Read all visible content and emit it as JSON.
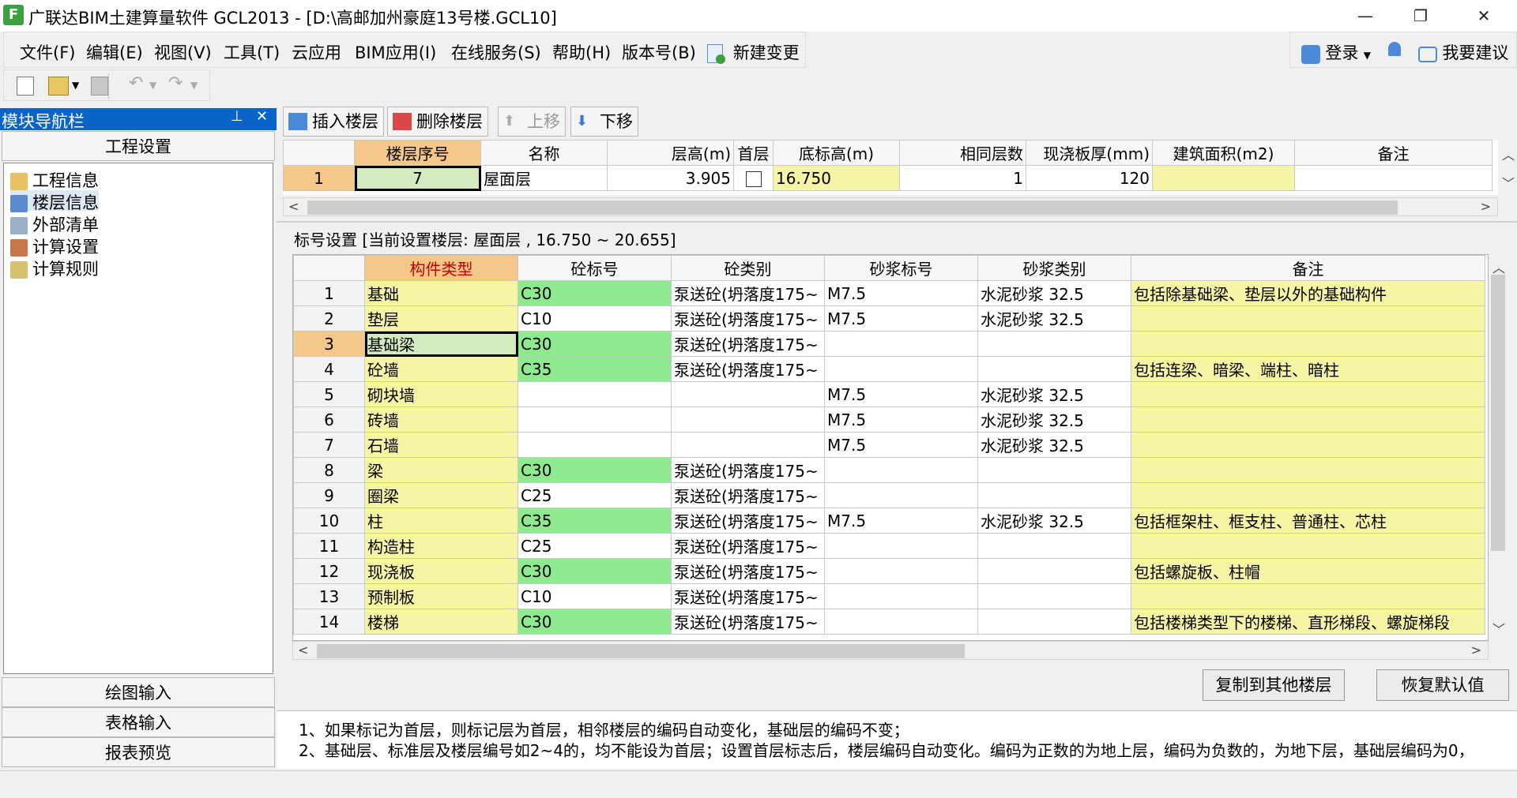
{
  "window": {
    "title": "广联达BIM土建算量软件 GCL2013 - [D:\\高邮加州豪庭13号楼.GCL10]",
    "app_icon": "F",
    "minimize": "—",
    "restore": "❐",
    "close": "✕"
  },
  "menu": [
    "文件(F)",
    "编辑(E)",
    "视图(V)",
    "工具(T)",
    "云应用",
    "BIM应用(I)",
    "在线服务(S)",
    "帮助(H)",
    "版本号(B)",
    "新建变更"
  ],
  "right_menu": {
    "login": "登录",
    "suggest": "我要建议"
  },
  "nav": {
    "title": "模块导航栏",
    "pin": "⊥",
    "close": "✕",
    "section": "工程设置",
    "tree": [
      "工程信息",
      "楼层信息",
      "外部清单",
      "计算设置",
      "计算规则"
    ],
    "bottom": [
      "绘图输入",
      "表格输入",
      "报表预览"
    ]
  },
  "floor_toolbar": {
    "insert": "插入楼层",
    "delete": "删除楼层",
    "up": "上移",
    "down": "下移"
  },
  "floor_table": {
    "headers": [
      "楼层序号",
      "名称",
      "层高(m)",
      "首层",
      "底标高(m)",
      "相同层数",
      "现浇板厚(mm)",
      "建筑面积(m2)",
      "备注"
    ],
    "rows": [
      {
        "row": "1",
        "seq": "7",
        "name": "屋面层",
        "height": "3.905",
        "first": false,
        "bottom": "16.750",
        "same": "1",
        "thick": "120",
        "area": "",
        "note": ""
      }
    ]
  },
  "grade_title": "标号设置 [当前设置楼层: 屋面层 , 16.750 ~ 20.655]",
  "grade_table": {
    "headers": [
      "构件类型",
      "砼标号",
      "砼类别",
      "砂浆标号",
      "砂浆类别",
      "备注"
    ],
    "rows": [
      {
        "n": "1",
        "type": "基础",
        "grade": "C30",
        "cat": "泵送砼(坍落度175~",
        "mgrade": "M7.5",
        "mcat": "水泥砂浆  32.5",
        "note": "包括除基础梁、垫层以外的基础构件",
        "green": true
      },
      {
        "n": "2",
        "type": "垫层",
        "grade": "C10",
        "cat": "泵送砼(坍落度175~",
        "mgrade": "M7.5",
        "mcat": "水泥砂浆  32.5",
        "note": "",
        "green": false
      },
      {
        "n": "3",
        "type": "基础梁",
        "grade": "C30",
        "cat": "泵送砼(坍落度175~",
        "mgrade": "",
        "mcat": "",
        "note": "",
        "green": true
      },
      {
        "n": "4",
        "type": "砼墙",
        "grade": "C35",
        "cat": "泵送砼(坍落度175~",
        "mgrade": "",
        "mcat": "",
        "note": "包括连梁、暗梁、端柱、暗柱",
        "green": true
      },
      {
        "n": "5",
        "type": "砌块墙",
        "grade": "",
        "cat": "",
        "mgrade": "M7.5",
        "mcat": "水泥砂浆  32.5",
        "note": "",
        "green": false
      },
      {
        "n": "6",
        "type": "砖墙",
        "grade": "",
        "cat": "",
        "mgrade": "M7.5",
        "mcat": "水泥砂浆  32.5",
        "note": "",
        "green": false
      },
      {
        "n": "7",
        "type": "石墙",
        "grade": "",
        "cat": "",
        "mgrade": "M7.5",
        "mcat": "水泥砂浆  32.5",
        "note": "",
        "green": false
      },
      {
        "n": "8",
        "type": "梁",
        "grade": "C30",
        "cat": "泵送砼(坍落度175~",
        "mgrade": "",
        "mcat": "",
        "note": "",
        "green": true
      },
      {
        "n": "9",
        "type": "圈梁",
        "grade": "C25",
        "cat": "泵送砼(坍落度175~",
        "mgrade": "",
        "mcat": "",
        "note": "",
        "green": false
      },
      {
        "n": "10",
        "type": "柱",
        "grade": "C35",
        "cat": "泵送砼(坍落度175~",
        "mgrade": "M7.5",
        "mcat": "水泥砂浆  32.5",
        "note": "包括框架柱、框支柱、普通柱、芯柱",
        "green": true
      },
      {
        "n": "11",
        "type": "构造柱",
        "grade": "C25",
        "cat": "泵送砼(坍落度175~",
        "mgrade": "",
        "mcat": "",
        "note": "",
        "green": false
      },
      {
        "n": "12",
        "type": "现浇板",
        "grade": "C30",
        "cat": "泵送砼(坍落度175~",
        "mgrade": "",
        "mcat": "",
        "note": "包括螺旋板、柱帽",
        "green": true
      },
      {
        "n": "13",
        "type": "预制板",
        "grade": "C10",
        "cat": "泵送砼(坍落度175~",
        "mgrade": "",
        "mcat": "",
        "note": "",
        "green": false
      },
      {
        "n": "14",
        "type": "楼梯",
        "grade": "C30",
        "cat": "泵送砼(坍落度175~",
        "mgrade": "",
        "mcat": "",
        "note": "包括楼梯类型下的楼梯、直形梯段、螺旋梯段",
        "green": true
      }
    ]
  },
  "buttons": {
    "copy": "复制到其他楼层",
    "restore": "恢复默认值"
  },
  "notes": [
    "1、如果标记为首层，则标记层为首层，相邻楼层的编码自动变化，基础层的编码不变；",
    "2、基础层、标准层及楼层编号如2~4的，均不能设为首层；设置首层标志后，楼层编码自动变化。编码为正数的为地上层，编码为负数的，为地下层，基础层编码为0，"
  ],
  "colors": {
    "nav_header": "#0a64c8",
    "yellow_cell": "#f5f5a5",
    "green_cell": "#8eea8e",
    "selected_header": "#f5c88a"
  }
}
